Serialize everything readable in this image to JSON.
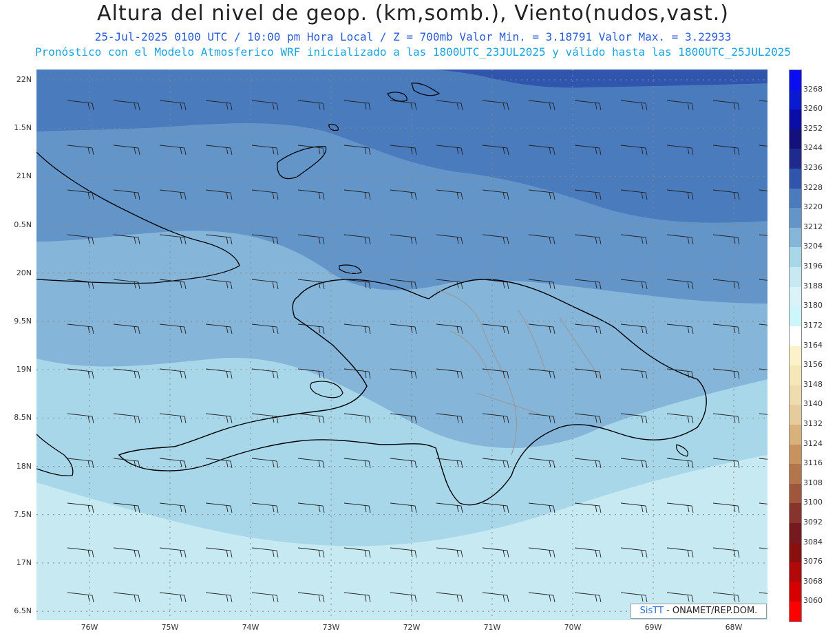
{
  "title": "Altura del nivel de geop. (km,somb.), Viento(nudos,vast.)",
  "subtitle1": "25-Jul-2025  0100 UTC / 10:00 pm Hora Local / Z = 700mb    Valor Min. = 3.18791  Valor Max. = 3.22933",
  "subtitle2": "Pronóstico con el Modelo Atmosferico WRF inicializado a las 1800UTC_23JUL2025 y válido hasta las  1800UTC_25JUL2025",
  "lat_labels": [
    "22N",
    "1.5N",
    "21N",
    "0.5N",
    "20N",
    "9.5N",
    "19N",
    "8.5N",
    "18N",
    "7.5N",
    "17N",
    "6.5N"
  ],
  "lon_labels": [
    "76W",
    "75W",
    "74W",
    "73W",
    "72W",
    "71W",
    "70W",
    "69W",
    "68W"
  ],
  "colorbar": {
    "labels": [
      "3268",
      "3260",
      "3252",
      "3244",
      "3236",
      "3228",
      "3220",
      "3212",
      "3204",
      "3196",
      "3188",
      "3180",
      "3172",
      "3164",
      "3156",
      "3148",
      "3140",
      "3132",
      "3124",
      "3116",
      "3108",
      "3100",
      "3092",
      "3084",
      "3076",
      "3068",
      "3060"
    ],
    "colors": [
      "#0a0cf2",
      "#0a1ad0",
      "#0b0da8",
      "#14117c",
      "#1f2a8e",
      "#2f55ad",
      "#4a7bbd",
      "#6495c9",
      "#86b5da",
      "#a8d7ea",
      "#c6e9f2",
      "#daf3f8",
      "#cdf6fb",
      "#ffffff",
      "#fbf2c9",
      "#f6e7b9",
      "#efdcae",
      "#e6cc9c",
      "#d9b17b",
      "#c9925c",
      "#b5754a",
      "#a0563a",
      "#88332c",
      "#771a1f",
      "#8a0f0f",
      "#b20808",
      "#d60000",
      "#ff0000"
    ]
  },
  "credit": {
    "brand": "SisTT",
    "text": " - ONAMET/REP.DOM."
  },
  "map_fill": {
    "deep": "#2f55ad",
    "dark": "#4a7bbd",
    "mid": "#6495c9",
    "light": "#86b5da",
    "pale": "#a8d7ea",
    "palest": "#c6e9f2"
  }
}
